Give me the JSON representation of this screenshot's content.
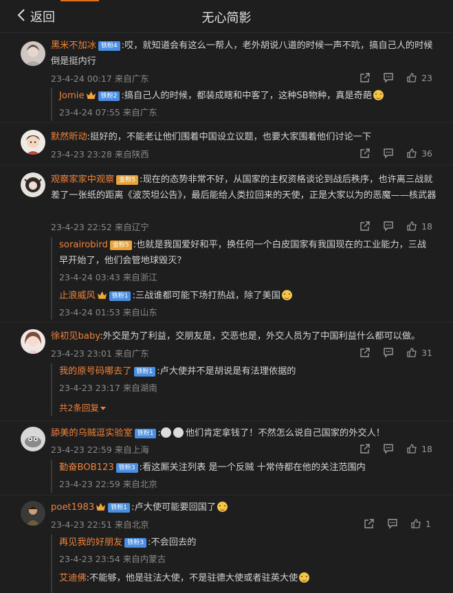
{
  "header": {
    "back_label": "返回",
    "title": "无心简影"
  },
  "colors": {
    "accent": "#f0833a",
    "bg": "#1e1e1e",
    "badge_blue": "#4a8fe4",
    "badge_gold": "#e8a43a"
  },
  "comments": [
    {
      "user": "黑米不加冰",
      "badge": "铁粉4",
      "text": ":哎，就知道会有这么一帮人，老外胡说八道的时候一声不吭，搞自己人的时候倒是挺内行",
      "meta": "23-4-24 00:17 来自广东",
      "likes": "23",
      "replies": [
        {
          "user": "Jomie",
          "badge": "铁粉2",
          "text": ":搞自己人的时候，都装成瞎和中客了，这种SB物种，真是奇葩",
          "time": "23-4-24 07:55 来自广东"
        }
      ]
    },
    {
      "user": "默然昕动",
      "badge": "",
      "text": ":挺好的，不能老让他们围着中国设立议题，也要大家围着他们讨论一下",
      "meta": "23-4-23 23:28 来自陕西",
      "likes": "36",
      "replies": []
    },
    {
      "user": "观察家家中观察",
      "badge": "金粉5",
      "text": ":现在的态势非常不好，从国家的主权资格谈论到战后秩序，也许离三战就差了一张纸的距离《波茨坦公告》，最后能给人类拉回来的天使，正是大家以为的恶魔——核武器",
      "meta": "23-4-23 22:52 来自辽宁",
      "likes": "18",
      "replies": [
        {
          "user": "sorairobird",
          "badge": "金粉5",
          "text": ":也就是我国爱好和平，换任何一个白皮国家有我国现在的工业能力，三战早开始了，他们会管地球毁灭？",
          "time": "23-4-24 03:43 来自浙江"
        },
        {
          "user": "止浪威风",
          "badge": "铁粉1",
          "text": ":三战谁都可能下场打热战，除了美国",
          "time": "23-4-24 01:53 来自山东"
        }
      ]
    },
    {
      "user": "徐初见baby",
      "badge": "",
      "text": ":外交是为了利益，交朋友是，交恶也是，外交人员为了中国利益什么都可以做。",
      "meta": "23-4-23 23:01 来自广东",
      "likes": "31",
      "replies": [
        {
          "user": "我的原号码哪去了",
          "badge": "铁粉1",
          "text": ":卢大使并不是胡说是有法理依据的",
          "time": "23-4-23 23:17 来自湖南"
        }
      ],
      "more_label": "共2条回复"
    },
    {
      "user": "舔美的乌贼逗实验室",
      "badge": "铁粉1",
      "text": "他们肯定拿钱了！不然怎么说自己国家的外交人！",
      "meta": "23-4-23 22:59 来自上海",
      "likes": "18",
      "replies": [
        {
          "user": "勤奋BOB123",
          "badge": "铁粉3",
          "text": ":看这厮关注列表 是一个反贼 十常侍都在他的关注范围内",
          "time": "23-4-23 22:59 来自北京"
        }
      ]
    },
    {
      "user": "poet1983",
      "badge": "铁粉1",
      "text": ":卢大使可能要回国了",
      "meta": "23-4-23 22:51 来自北京",
      "likes": "1",
      "replies": [
        {
          "user": "再见我的好朋友",
          "badge": "铁粉3",
          "text": ":不会回去的",
          "time": "23-4-23 23:54 来自内蒙古"
        },
        {
          "user": "艾迪佛",
          "badge": "",
          "text": ":不能够，他是驻法大使，不是驻德大使或者驻英大使",
          "time": ""
        }
      ]
    }
  ]
}
